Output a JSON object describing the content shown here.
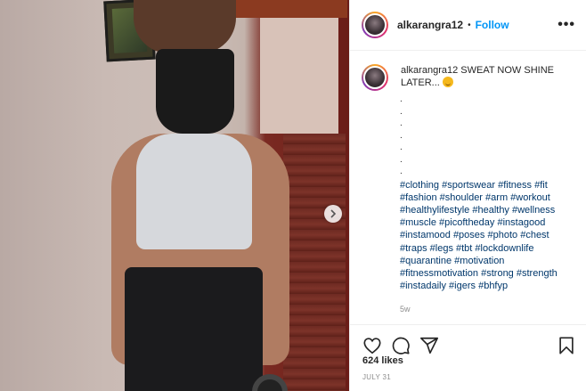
{
  "post": {
    "username": "alkarangra12",
    "separator": "•",
    "follow_label": "Follow",
    "more_label": "•••",
    "caption_user": "alkarangra12",
    "caption_text": "SWEAT NOW SHINE LATER...",
    "caption_dots": [
      ".",
      ".",
      ".",
      ".",
      ".",
      ".",
      "."
    ],
    "hashtags": [
      "#clothing",
      "#sportswear",
      "#fitness",
      "#fit",
      "#fashion",
      "#shoulder",
      "#arm",
      "#workout",
      "#healthylifestyle",
      "#healthy",
      "#wellness",
      "#muscle",
      "#picoftheday",
      "#instagood",
      "#instamood",
      "#poses",
      "#photo",
      "#chest",
      "#traps",
      "#legs",
      "#tbt",
      "#lockdownlife",
      "#quarantine",
      "#motivation",
      "#fitnessmotivation",
      "#strong",
      "#strength",
      "#instadaily",
      "#igers",
      "#bhfyp"
    ],
    "age": "5w",
    "likes": "624 likes",
    "date": "JULY 31"
  },
  "icons": {
    "like": "heart-icon",
    "comment": "comment-icon",
    "share": "share-icon",
    "save": "bookmark-icon",
    "next": "chevron-right-icon"
  },
  "colors": {
    "follow": "#0095f6",
    "hashtag": "#00376b",
    "muted": "#8e8e8e"
  }
}
